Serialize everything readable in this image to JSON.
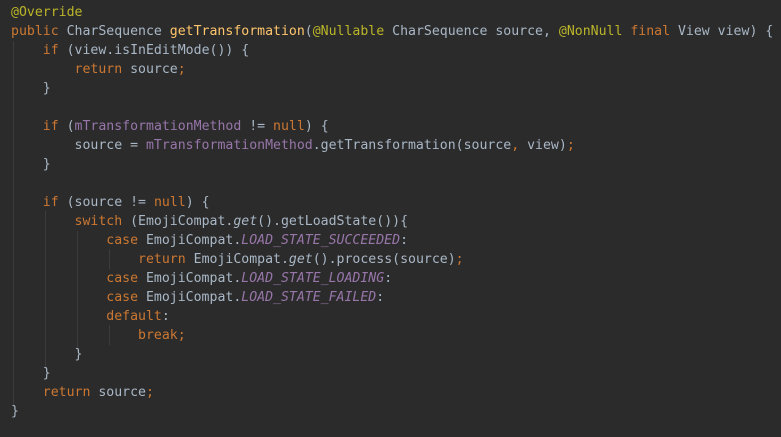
{
  "editor": {
    "theme_colors": {
      "background": "#2b2b2b",
      "keyword": "#cc7832",
      "annotation": "#bbb529",
      "method_declaration": "#ffc66d",
      "field": "#9876aa",
      "plain": "#a9b7c6"
    },
    "lines": [
      [
        [
          "ann",
          "@Override"
        ]
      ],
      [
        [
          "kw",
          "public "
        ],
        [
          "plain",
          "CharSequence "
        ],
        [
          "fn",
          "getTransformation"
        ],
        [
          "plain",
          "("
        ],
        [
          "ann",
          "@Nullable "
        ],
        [
          "plain",
          "CharSequence source, "
        ],
        [
          "ann",
          "@NonNull "
        ],
        [
          "kw",
          "final "
        ],
        [
          "plain",
          "View view) {"
        ]
      ],
      [
        [
          "plain",
          "    "
        ],
        [
          "kw",
          "if "
        ],
        [
          "plain",
          "(view.isInEditMode()) {"
        ]
      ],
      [
        [
          "plain",
          "        "
        ],
        [
          "kw",
          "return "
        ],
        [
          "plain",
          "source"
        ],
        [
          "kw",
          ";"
        ]
      ],
      [
        [
          "plain",
          "    }"
        ]
      ],
      [
        [
          "plain",
          ""
        ]
      ],
      [
        [
          "plain",
          "    "
        ],
        [
          "kw",
          "if "
        ],
        [
          "plain",
          "("
        ],
        [
          "field",
          "mTransformationMethod "
        ],
        [
          "plain",
          "!= "
        ],
        [
          "kw",
          "null"
        ],
        [
          "plain",
          ") {"
        ]
      ],
      [
        [
          "plain",
          "        source = "
        ],
        [
          "field",
          "mTransformationMethod"
        ],
        [
          "plain",
          ".getTransformation(source"
        ],
        [
          "kw",
          ", "
        ],
        [
          "plain",
          "view)"
        ],
        [
          "kw",
          ";"
        ]
      ],
      [
        [
          "plain",
          "    }"
        ]
      ],
      [
        [
          "plain",
          ""
        ]
      ],
      [
        [
          "plain",
          "    "
        ],
        [
          "kw",
          "if "
        ],
        [
          "plain",
          "(source != "
        ],
        [
          "kw",
          "null"
        ],
        [
          "plain",
          ") {"
        ]
      ],
      [
        [
          "plain",
          "        "
        ],
        [
          "kw",
          "switch "
        ],
        [
          "plain",
          "(EmojiCompat."
        ],
        [
          "static",
          "get"
        ],
        [
          "plain",
          "().getLoadState()){"
        ]
      ],
      [
        [
          "plain",
          "            "
        ],
        [
          "kw",
          "case "
        ],
        [
          "plain",
          "EmojiCompat."
        ],
        [
          "const",
          "LOAD_STATE_SUCCEEDED"
        ],
        [
          "plain",
          ":"
        ]
      ],
      [
        [
          "plain",
          "                "
        ],
        [
          "kw",
          "return "
        ],
        [
          "plain",
          "EmojiCompat."
        ],
        [
          "static",
          "get"
        ],
        [
          "plain",
          "().process(source)"
        ],
        [
          "kw",
          ";"
        ]
      ],
      [
        [
          "plain",
          "            "
        ],
        [
          "kw",
          "case "
        ],
        [
          "plain",
          "EmojiCompat."
        ],
        [
          "const",
          "LOAD_STATE_LOADING"
        ],
        [
          "plain",
          ":"
        ]
      ],
      [
        [
          "plain",
          "            "
        ],
        [
          "kw",
          "case "
        ],
        [
          "plain",
          "EmojiCompat."
        ],
        [
          "const",
          "LOAD_STATE_FAILED"
        ],
        [
          "plain",
          ":"
        ]
      ],
      [
        [
          "plain",
          "            "
        ],
        [
          "kw",
          "default"
        ],
        [
          "plain",
          ":"
        ]
      ],
      [
        [
          "plain",
          "                "
        ],
        [
          "kw",
          "break;"
        ]
      ],
      [
        [
          "plain",
          "        }"
        ]
      ],
      [
        [
          "plain",
          "    }"
        ]
      ],
      [
        [
          "plain",
          "    "
        ],
        [
          "kw",
          "return "
        ],
        [
          "plain",
          "source"
        ],
        [
          "kw",
          ";"
        ]
      ],
      [
        [
          "plain",
          "}"
        ]
      ]
    ]
  }
}
